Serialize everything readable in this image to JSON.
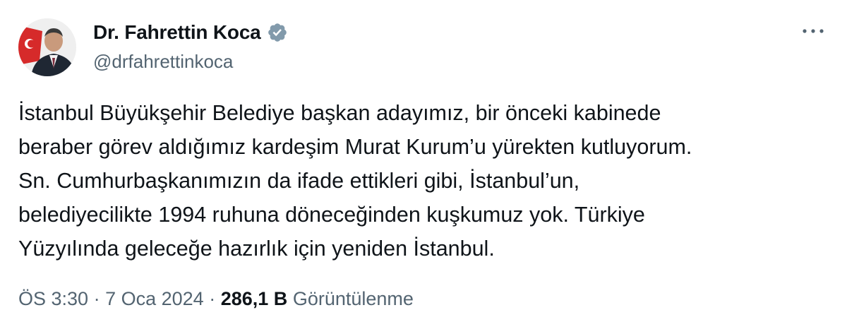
{
  "author": {
    "display_name": "Dr. Fahrettin Koca",
    "handle": "@drfahrettinkoca",
    "verified_icon": "verified-badge-icon",
    "verified_color": "#829aab"
  },
  "menu": {
    "more_icon": "more-options-icon"
  },
  "tweet": {
    "lines": [
      "İstanbul Büyükşehir Belediye başkan adayımız, bir önceki kabinede",
      "beraber görev aldığımız kardeşim Murat Kurum’u yürekten kutluyorum.",
      "Sn. Cumhurbaşkanımızın da ifade ettikleri gibi, İstanbul’un,",
      "belediyecilikte 1994 ruhuna döneceğinden kuşkumuz yok. Türkiye",
      "Yüzyılında geleceğe hazırlık için yeniden İstanbul."
    ]
  },
  "meta": {
    "time": "ÖS 3:30",
    "separator": "·",
    "date": "7 Oca 2024",
    "views_count": "286,1 B",
    "views_label": "Görüntülenme"
  }
}
